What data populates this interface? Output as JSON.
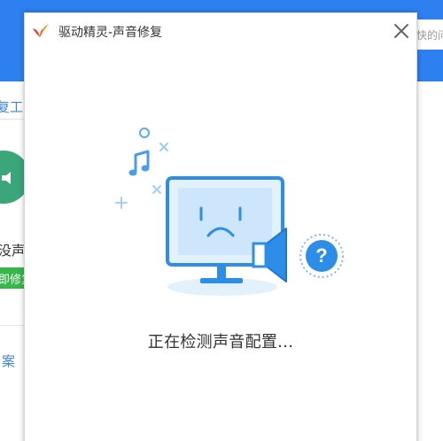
{
  "background_app": {
    "search_placeholder": "快的问",
    "tab_label": "复工",
    "silent_label": "没声",
    "fix_button_label": "即修复",
    "plan_link": "案"
  },
  "dialog": {
    "title": "驱动精灵-声音修复",
    "status_text": "正在检测声音配置..."
  },
  "icons": {
    "logo": "driver-genius-logo-icon",
    "close": "close-icon",
    "illustration": "sad-monitor-speaker-question-icon"
  },
  "colors": {
    "topbar": "#2e7ff0",
    "accent": "#2e8de8",
    "fix_button": "#36b64b",
    "sound_circle": "#3aa67a"
  }
}
